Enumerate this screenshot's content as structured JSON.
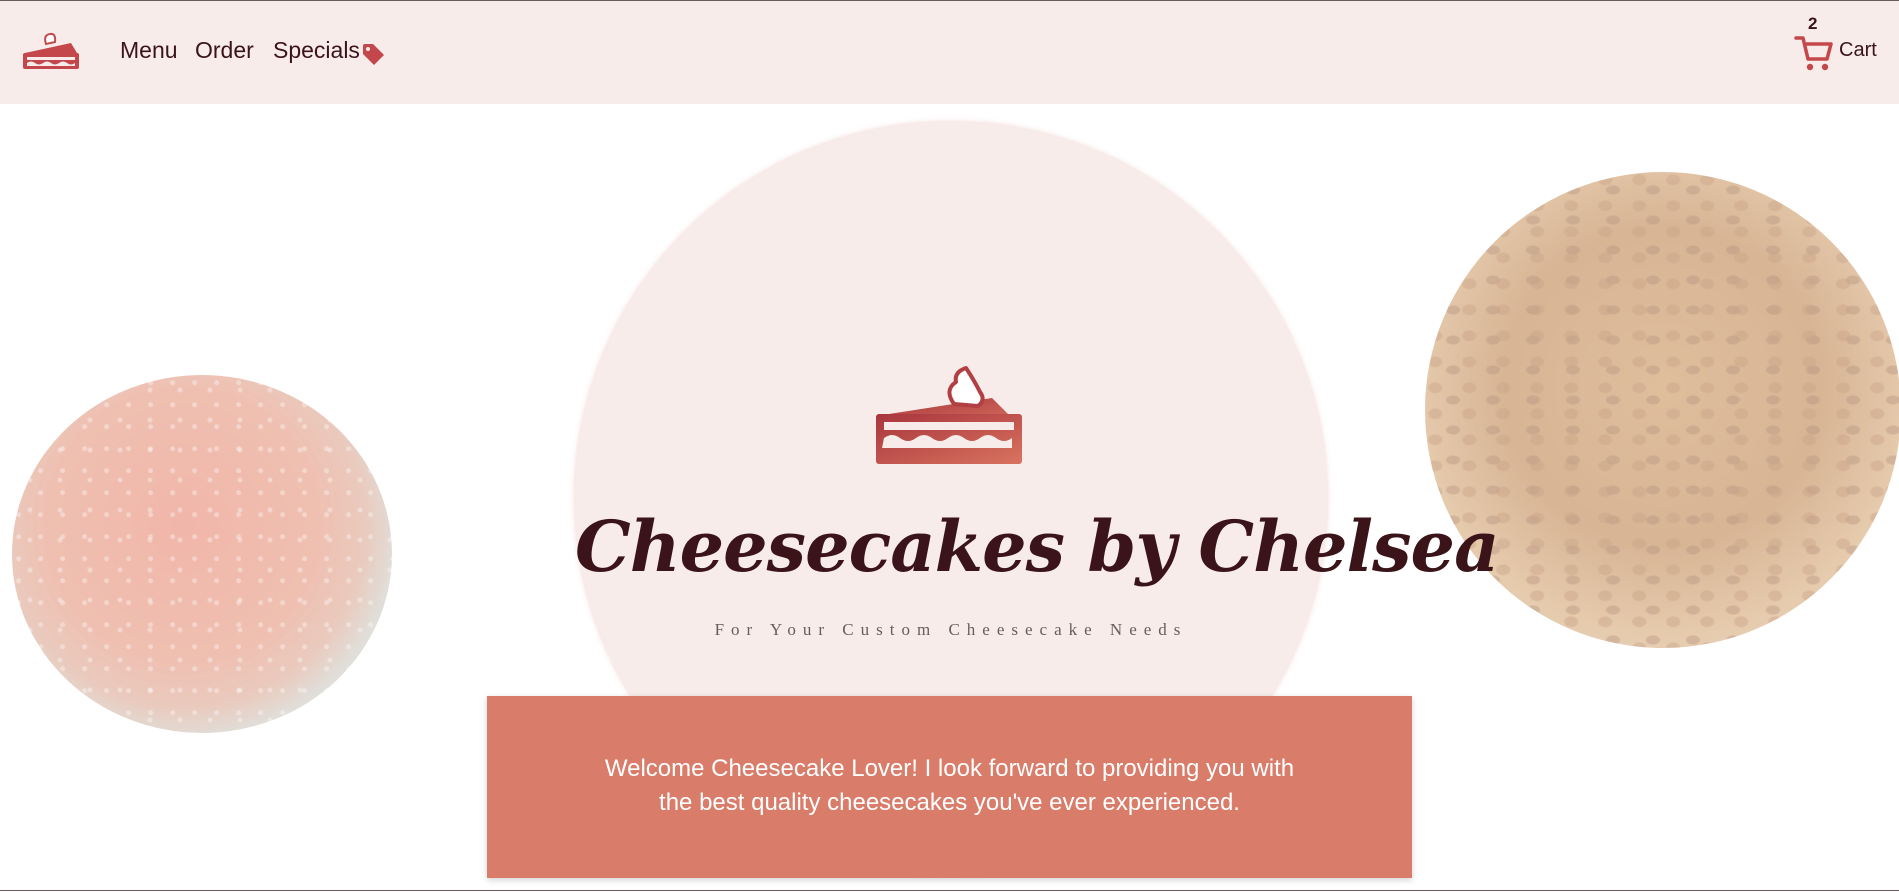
{
  "nav": {
    "logo_icon": "cheesecake-slice-icon",
    "links": [
      {
        "label": "Menu"
      },
      {
        "label": "Order"
      },
      {
        "label": "Specials",
        "icon": "tag-icon"
      }
    ],
    "cart": {
      "count": "2",
      "label": "Cart",
      "icon": "cart-icon"
    }
  },
  "hero": {
    "icon": "cheesecake-slice-icon",
    "title": "Cheesecakes by Chelsea",
    "subtitle": "For Your Custom Cheesecake Needs"
  },
  "welcome": {
    "line1": "Welcome Cheesecake Lover! I look forward to providing you with",
    "line2": "the best quality cheesecakes you've ever experienced."
  },
  "colors": {
    "navbar_bg": "#f8ecea",
    "accent": "#c4484b",
    "text_dark": "#3a1419",
    "welcome_bg": "#d97c69"
  }
}
